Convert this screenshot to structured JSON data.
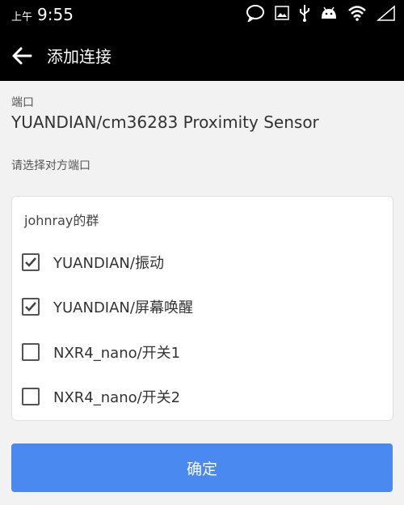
{
  "status_bar": {
    "ampm": "上午",
    "time": "9:55",
    "icons": [
      "chat-icon",
      "image-icon",
      "usb-icon",
      "android-icon",
      "wifi-icon",
      "signal-icon"
    ]
  },
  "toolbar": {
    "title": "添加连接",
    "back_icon": "arrow-left-icon"
  },
  "port": {
    "label": "端口",
    "value": "YUANDIAN/cm36283 Proximity Sensor"
  },
  "prompt": "请选择对方端口",
  "group": {
    "name": "johnray的群",
    "options": [
      {
        "label": "YUANDIAN/振动",
        "checked": true
      },
      {
        "label": "YUANDIAN/屏幕唤醒",
        "checked": true
      },
      {
        "label": "NXR4_nano/开关1",
        "checked": false
      },
      {
        "label": "NXR4_nano/开关2",
        "checked": false
      }
    ]
  },
  "confirm_label": "确定",
  "colors": {
    "accent": "#4a89f0",
    "bar": "#000000",
    "background": "#f2f2f2"
  }
}
